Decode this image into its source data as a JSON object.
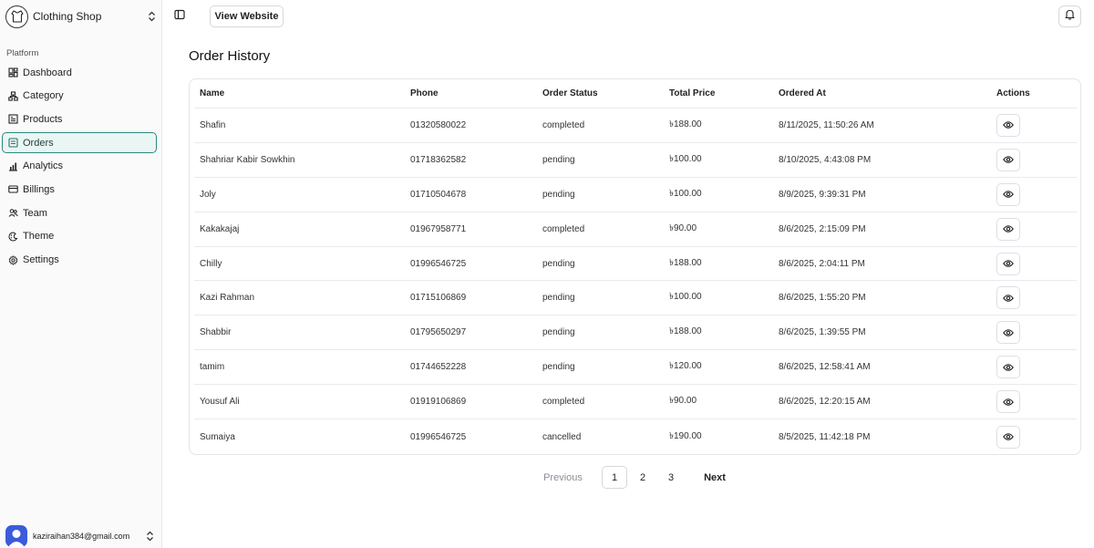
{
  "sidebar": {
    "shop_name": "Clothing Shop",
    "section_label": "Platform",
    "items": [
      {
        "label": "Dashboard",
        "icon": "dashboard-icon"
      },
      {
        "label": "Category",
        "icon": "category-icon"
      },
      {
        "label": "Products",
        "icon": "products-icon"
      },
      {
        "label": "Orders",
        "icon": "orders-icon",
        "active": true
      },
      {
        "label": "Analytics",
        "icon": "analytics-icon"
      },
      {
        "label": "Billings",
        "icon": "billings-icon"
      },
      {
        "label": "Team",
        "icon": "team-icon"
      },
      {
        "label": "Theme",
        "icon": "theme-icon"
      },
      {
        "label": "Settings",
        "icon": "settings-icon"
      }
    ],
    "user_email": "kaziraihan384@gmail.com"
  },
  "header": {
    "view_website_label": "View Website"
  },
  "main": {
    "title": "Order History",
    "columns": [
      "Name",
      "Phone",
      "Order Status",
      "Total Price",
      "Ordered At",
      "Actions"
    ],
    "rows": [
      {
        "name": "Shafin",
        "phone": "01320580022",
        "status": "completed",
        "price": "৳188.00",
        "ordered_at": "8/11/2025, 11:50:26 AM"
      },
      {
        "name": "Shahriar Kabir Sowkhin",
        "phone": "01718362582",
        "status": "pending",
        "price": "৳100.00",
        "ordered_at": "8/10/2025, 4:43:08 PM"
      },
      {
        "name": "Joly",
        "phone": "01710504678",
        "status": "pending",
        "price": "৳100.00",
        "ordered_at": "8/9/2025, 9:39:31 PM"
      },
      {
        "name": "Kakakajaj",
        "phone": "01967958771",
        "status": "completed",
        "price": "৳90.00",
        "ordered_at": "8/6/2025, 2:15:09 PM"
      },
      {
        "name": "Chilly",
        "phone": "01996546725",
        "status": "pending",
        "price": "৳188.00",
        "ordered_at": "8/6/2025, 2:04:11 PM"
      },
      {
        "name": "Kazi Rahman",
        "phone": "01715106869",
        "status": "pending",
        "price": "৳100.00",
        "ordered_at": "8/6/2025, 1:55:20 PM"
      },
      {
        "name": "Shabbir",
        "phone": "01795650297",
        "status": "pending",
        "price": "৳188.00",
        "ordered_at": "8/6/2025, 1:39:55 PM"
      },
      {
        "name": "tamim",
        "phone": "01744652228",
        "status": "pending",
        "price": "৳120.00",
        "ordered_at": "8/6/2025, 12:58:41 AM"
      },
      {
        "name": "Yousuf Ali",
        "phone": "01919106869",
        "status": "completed",
        "price": "৳90.00",
        "ordered_at": "8/6/2025, 12:20:15 AM"
      },
      {
        "name": "Sumaiya",
        "phone": "01996546725",
        "status": "cancelled",
        "price": "৳190.00",
        "ordered_at": "8/5/2025, 11:42:18 PM"
      }
    ]
  },
  "pagination": {
    "previous": "Previous",
    "pages": [
      "1",
      "2",
      "3"
    ],
    "current": "1",
    "next": "Next"
  },
  "colors": {
    "active_border": "#2b8a7e",
    "active_bg": "#eaf6f4",
    "avatar_bg": "#3b5bdb"
  }
}
